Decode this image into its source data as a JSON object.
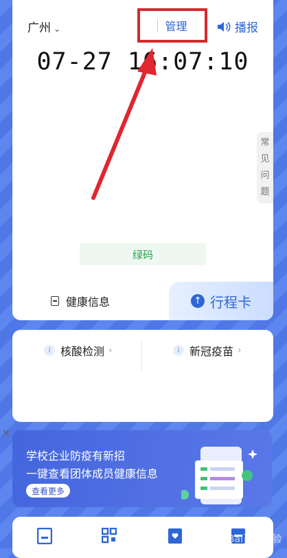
{
  "header": {
    "city": "广州",
    "manage_label": "管理",
    "broadcast_label": "播报",
    "datetime": "07-27 16:07:10"
  },
  "sidebar": {
    "faq_label": "常\n见\n问\n题"
  },
  "code": {
    "status_label": "绿码",
    "health_info_label": "健康信息",
    "trip_card_label": "行程卡"
  },
  "services": {
    "items": [
      {
        "label": "核酸检测"
      },
      {
        "label": "新冠疫苗"
      }
    ]
  },
  "banner": {
    "line1": "学校企业防疫有新招",
    "line2": "一键查看团体成员健康信息",
    "button_label": "查看更多",
    "close_icon": "×"
  },
  "colors": {
    "accent": "#2f66d6",
    "highlight_box": "#d42a2f",
    "green": "#27a54b",
    "background": "#5d86ee"
  },
  "watermark": "Bai百度经验"
}
